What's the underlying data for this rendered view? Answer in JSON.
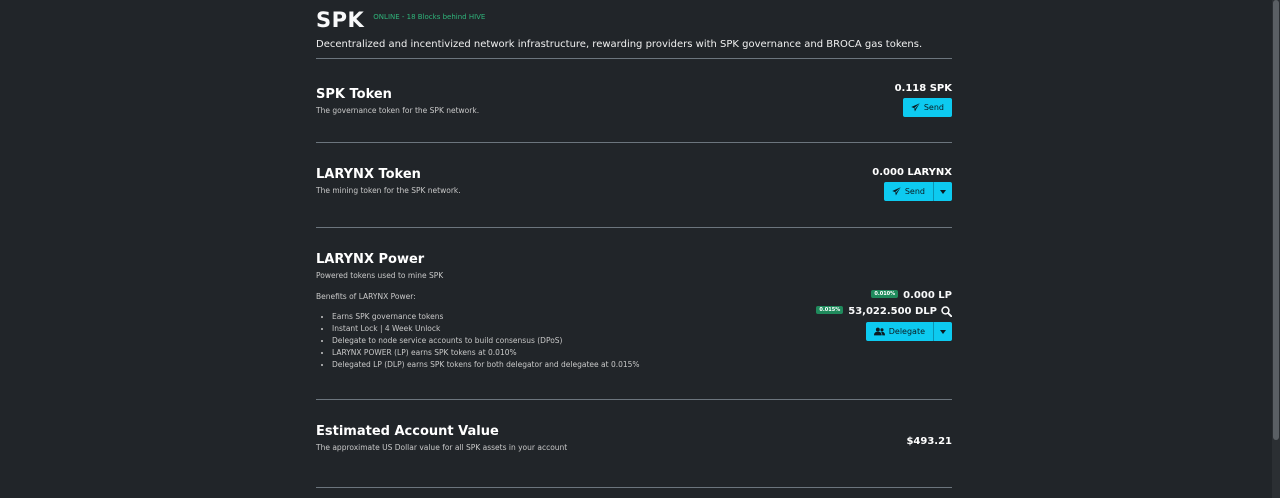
{
  "header": {
    "title": "SPK",
    "status": "ONLINE - 18 Blocks behind HIVE",
    "tagline": "Decentralized and incentivized network infrastructure, rewarding providers with SPK governance and BROCA gas tokens."
  },
  "spk_token": {
    "title": "SPK Token",
    "description": "The governance token for the SPK network.",
    "amount": "0.118 SPK",
    "send_label": "Send"
  },
  "larynx_token": {
    "title": "LARYNX Token",
    "description": "The mining token for the SPK network.",
    "amount": "0.000 LARYNX",
    "send_label": "Send"
  },
  "larynx_power": {
    "title": "LARYNX Power",
    "description": "Powered tokens used to mine SPK",
    "benefits_title": "Benefits of LARYNX Power:",
    "benefits": [
      "Earns SPK governance tokens",
      "Instant Lock | 4 Week Unlock",
      "Delegate to node service accounts to build consensus (DPoS)",
      "LARYNX POWER (LP) earns SPK tokens at 0.010%",
      "Delegated LP (DLP) earns SPK tokens for both delegator and delegatee at 0.015%"
    ],
    "lp_badge": "0.010%",
    "lp_amount": "0.000 LP",
    "dlp_badge": "0.015%",
    "dlp_amount": "53,022.500 DLP",
    "delegate_label": "Delegate"
  },
  "estimated_value": {
    "title": "Estimated Account Value",
    "description": "The approximate US Dollar value for all SPK assets in your account",
    "amount": "$493.21"
  }
}
